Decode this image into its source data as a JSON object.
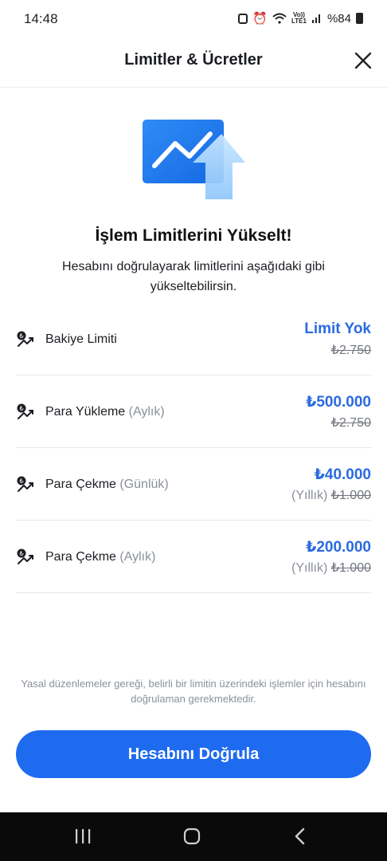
{
  "status_bar": {
    "time": "14:48",
    "battery": "%84",
    "network": "LTE1",
    "volte": "Vo))"
  },
  "header": {
    "title": "Limitler & Ücretler",
    "close_icon": "close-icon"
  },
  "hero": {
    "icon": "chart-up-arrow-illustration"
  },
  "main": {
    "title": "İşlem Limitlerini Yükselt!",
    "description": "Hesabını doğrulayarak limitlerini aşağıdaki gibi yükseltebilirsin."
  },
  "limits": [
    {
      "label": "Bakiye Limiti",
      "sub": "",
      "value": "Limit Yok",
      "old_prefix": "",
      "old_value": "₺2.750"
    },
    {
      "label": "Para Yükleme",
      "sub": "(Aylık)",
      "value": "₺500.000",
      "old_prefix": "",
      "old_value": "₺2.750"
    },
    {
      "label": "Para Çekme",
      "sub": "(Günlük)",
      "value": "₺40.000",
      "old_prefix": "(Yıllık)",
      "old_value": "₺1.000"
    },
    {
      "label": "Para Çekme",
      "sub": "(Aylık)",
      "value": "₺200.000",
      "old_prefix": "(Yıllık)",
      "old_value": "₺1.000"
    }
  ],
  "legal_note": "Yasal düzenlemeler gereği, belirli bir limitin üzerindeki işlemler için hesabını doğrulaman gerekmektedir.",
  "cta": {
    "label": "Hesabını Doğrula"
  },
  "colors": {
    "accent": "#1f6bf0",
    "value_blue": "#2a6be0",
    "muted": "#8a9099"
  }
}
